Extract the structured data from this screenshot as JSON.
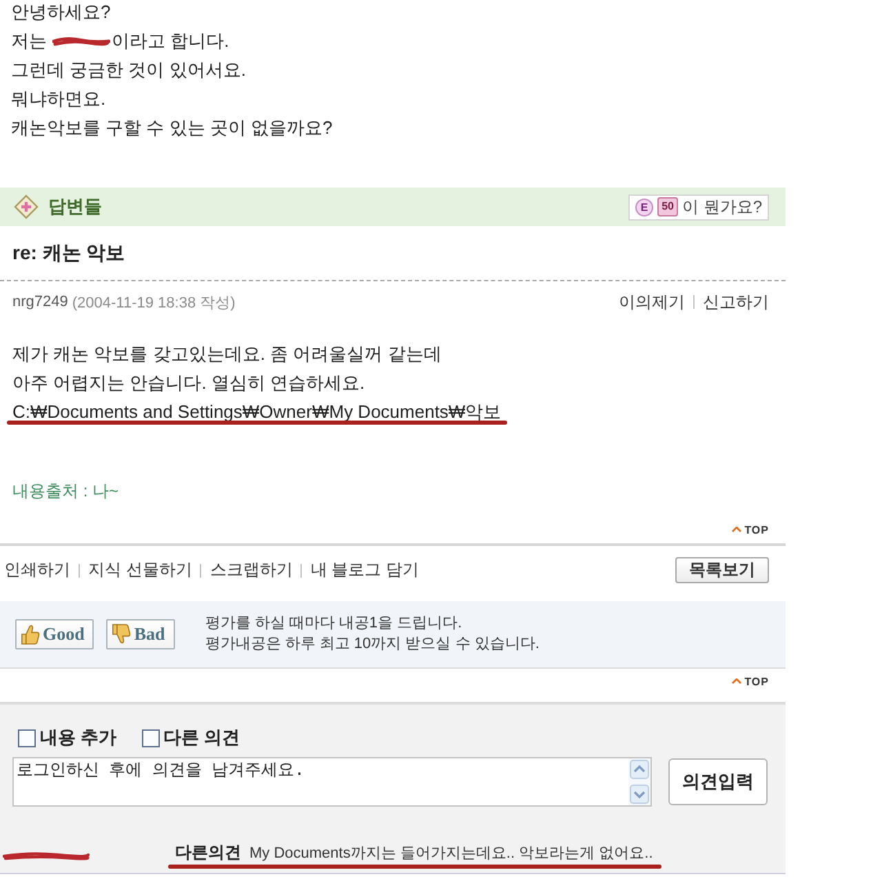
{
  "question": {
    "lines": [
      {
        "parts": [
          {
            "kind": "text",
            "text": "안녕하세요?"
          }
        ]
      },
      {
        "parts": [
          {
            "kind": "text",
            "text": "저는"
          },
          {
            "kind": "redacted"
          },
          {
            "kind": "text",
            "text": "이라고 합니다."
          }
        ]
      },
      {
        "parts": [
          {
            "kind": "text",
            "text": "그런데 궁금한 것이 있어서요."
          }
        ]
      },
      {
        "parts": [
          {
            "kind": "text",
            "text": "뭐냐하면요."
          }
        ]
      },
      {
        "parts": [
          {
            "kind": "text",
            "text": "캐논악보를 구할 수 있는 곳이 없을까요?"
          }
        ]
      }
    ]
  },
  "answers_header": {
    "title": "답변들",
    "grade": "E",
    "points": "50",
    "help": "이 뭔가요?"
  },
  "answer": {
    "title": "re: 캐논 악보",
    "author": "nrg7249",
    "date": "(2004-11-19 18:38 작성)",
    "actions": [
      "이의제기",
      "신고하기"
    ],
    "body": [
      {
        "text": "제가 캐논 악보를 갖고있는데요. 좀 어려울실꺼 같는데",
        "underlined": false
      },
      {
        "text": "아주 어렵지는 안습니다. 열심히 연습하세요.",
        "underlined": false
      },
      {
        "text": "C:₩Documents and Settings₩Owner₩My Documents₩악보",
        "underlined": true
      }
    ],
    "source": "내용출처 : 나~",
    "top": "TOP"
  },
  "tools": {
    "links": [
      "인쇄하기",
      "지식 선물하기",
      "스크랩하기",
      "내 블로그 담기"
    ],
    "list_button": "목록보기"
  },
  "rating": {
    "buttons": [
      {
        "kind": "good",
        "label": "Good"
      },
      {
        "kind": "bad",
        "label": "Bad"
      }
    ],
    "notes": [
      "평가를 하실 때마다 내공1을 드립니다.",
      "평가내공은 하루 최고 10까지 받으실 수 있습니다."
    ],
    "top": "TOP"
  },
  "opinion_form": {
    "options": [
      {
        "label": "내용 추가",
        "checked": false
      },
      {
        "label": "다른 의견",
        "checked": false
      }
    ],
    "value": "로그인하신 후에 의견을 남겨주세요.",
    "submit": "의견입력"
  },
  "comments": [
    {
      "author_redacted": true,
      "label": "다른의견",
      "text": "My Documents까지는 들어가지는데요.. 악보라는게 없어요..",
      "underlined": true
    }
  ]
}
